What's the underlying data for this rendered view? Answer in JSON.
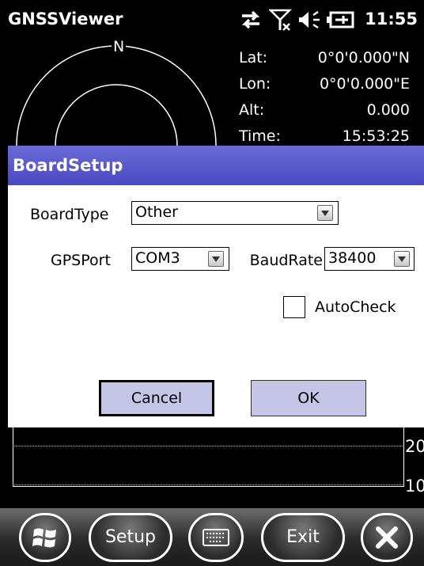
{
  "status_bar": {
    "app_title": "GNSSViewer",
    "time": "11:55",
    "icons": [
      "sync-arrows-icon",
      "no-signal-icon",
      "volume-icon",
      "battery-charging-icon"
    ]
  },
  "gps_info": {
    "lat_label": "Lat:",
    "lat_value": "0°0'0.000\"N",
    "lon_label": "Lon:",
    "lon_value": "0°0'0.000\"E",
    "alt_label": "Alt:",
    "alt_value": "0.000",
    "time_label": "Time:",
    "time_value": "15:53:25"
  },
  "skyplot": {
    "north_label": "N"
  },
  "dialog": {
    "title": "BoardSetup",
    "board_type_label": "BoardType",
    "board_type_value": "Other",
    "gps_port_label": "GPSPort",
    "gps_port_value": "COM3",
    "baud_rate_label": "BaudRate",
    "baud_rate_value": "38400",
    "auto_check_label": "AutoCheck",
    "cancel_label": "Cancel",
    "ok_label": "OK"
  },
  "chart": {
    "tick_labels": [
      "20",
      "10"
    ]
  },
  "taskbar": {
    "setup_label": "Setup",
    "exit_label": "Exit"
  },
  "colors": {
    "dialog_header": "#4b4bc3",
    "button_fill": "#c5c5e8",
    "background": "#000000"
  }
}
